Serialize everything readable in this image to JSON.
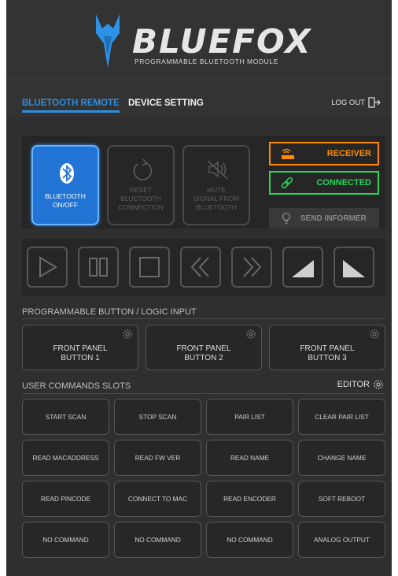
{
  "brand": {
    "name": "BLUEFOX",
    "subtitle": "PROGRAMMABLE BLUETOOTH MODULE",
    "accent": "#2c8fe0"
  },
  "nav": {
    "tabs": [
      {
        "label": "BLUETOOTH REMOTE",
        "active": true
      },
      {
        "label": "DEVICE SETTING",
        "active": false
      }
    ],
    "logout_label": "LOG OUT"
  },
  "controls": {
    "bluetooth_toggle": {
      "label_1": "BLUETOOTH",
      "label_2": "ON/OFF",
      "active": true,
      "icon": "bluetooth-icon"
    },
    "reset": {
      "label_1": "RESET",
      "label_2": "BLUETOOTH",
      "label_3": "CONNECTION",
      "icon": "reset-icon"
    },
    "mute": {
      "label_1": "MUTE",
      "label_2": "SIGNAL FROM",
      "label_3": "BLUETOOTH",
      "icon": "mute-icon"
    }
  },
  "status": {
    "receiver": {
      "label": "RECEIVER",
      "color": "#ff8a00",
      "icon": "router-icon"
    },
    "connected": {
      "label": "CONNECTED",
      "color": "#2bd65a",
      "icon": "link-icon"
    },
    "informer": {
      "label": "SEND INFORMER",
      "icon": "lightbulb-icon"
    }
  },
  "media": [
    "play-icon",
    "pause-icon",
    "stop-icon",
    "rewind-icon",
    "fast-forward-icon",
    "volume-up-icon",
    "volume-down-icon"
  ],
  "programmable": {
    "title": "PROGRAMMABLE BUTTON / LOGIC INPUT",
    "buttons": [
      {
        "line1": "FRONT PANEL",
        "line2": "BUTTON 1"
      },
      {
        "line1": "FRONT PANEL",
        "line2": "BUTTON 2"
      },
      {
        "line1": "FRONT PANEL",
        "line2": "BUTTON 3"
      }
    ]
  },
  "commands": {
    "title": "USER COMMANDS SLOTS",
    "editor_label": "EDITOR",
    "slots": [
      "START SCAN",
      "STOP SCAN",
      "PAIR LIST",
      "CLEAR PAIR LIST",
      "READ MACADDRESS",
      "READ FW VER",
      "READ NAME",
      "CHANGE NAME",
      "READ PINCODE",
      "CONNECT TO MAC",
      "READ ENCODER",
      "SOFT REBOOT",
      "NO COMMAND",
      "NO COMMAND",
      "NO COMMAND",
      "ANALOG OUTPUT"
    ]
  }
}
